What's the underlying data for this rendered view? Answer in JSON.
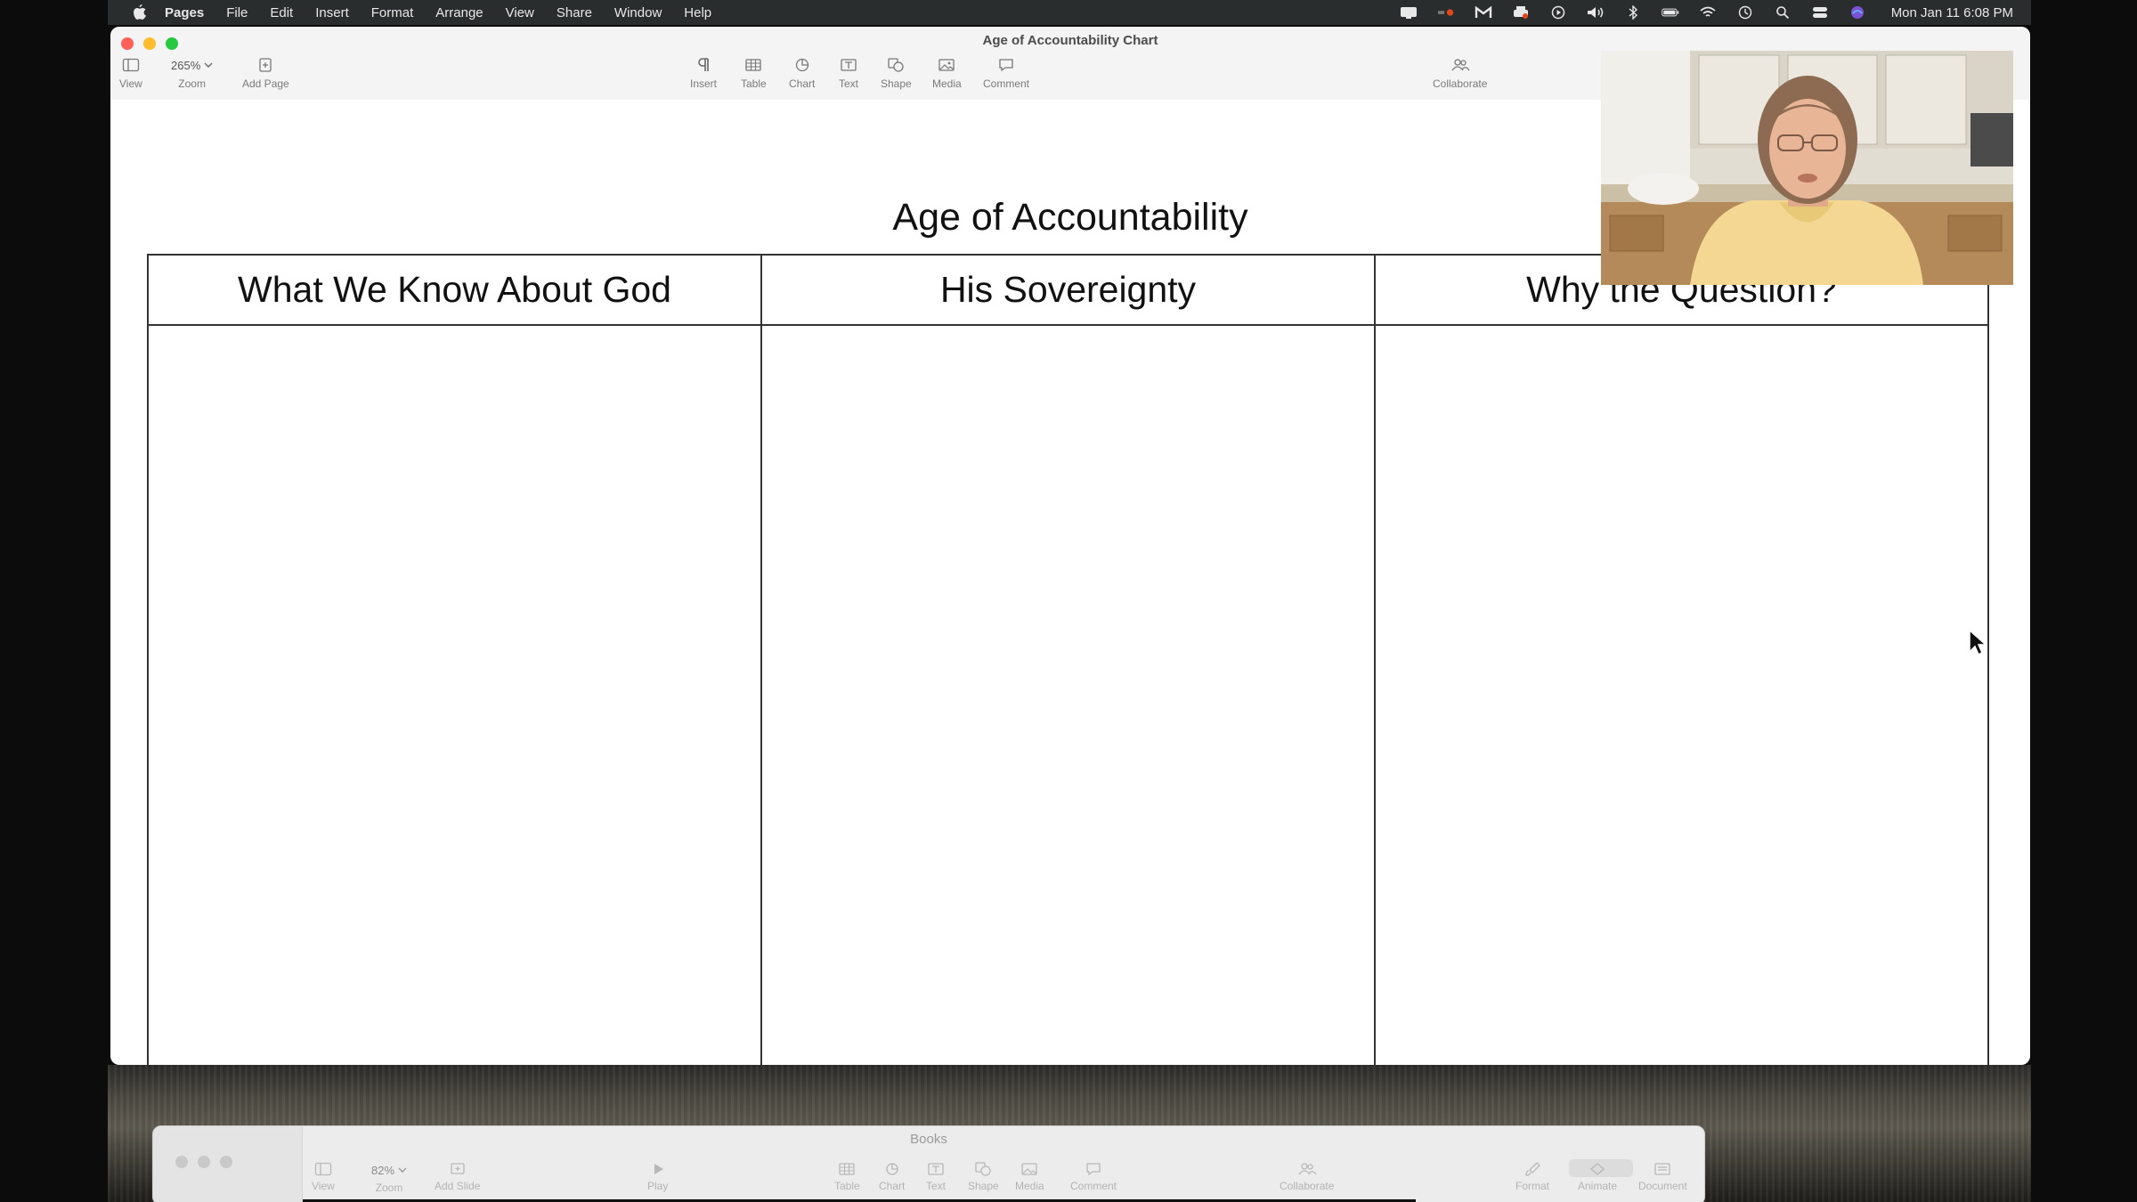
{
  "menubar": {
    "app_name": "Pages",
    "menus": [
      "File",
      "Edit",
      "Insert",
      "Format",
      "Arrange",
      "View",
      "Share",
      "Window",
      "Help"
    ],
    "clock": "Mon Jan 11  6:08 PM"
  },
  "window": {
    "title": "Age of Accountability Chart",
    "toolbar": {
      "view": "View",
      "zoom_value": "265%",
      "zoom": "Zoom",
      "add_page": "Add Page",
      "insert": "Insert",
      "table": "Table",
      "chart": "Chart",
      "text": "Text",
      "shape": "Shape",
      "media": "Media",
      "comment": "Comment",
      "collaborate": "Collaborate"
    }
  },
  "document": {
    "title": "Age of Accountability",
    "columns": [
      {
        "header": "What We Know About God"
      },
      {
        "header": "His Sovereignty"
      },
      {
        "header": "Why the Question?"
      }
    ]
  },
  "background_window": {
    "title": "Books",
    "toolbar": {
      "view": "View",
      "zoom_value": "82%",
      "zoom": "Zoom",
      "add_slide": "Add Slide",
      "play": "Play",
      "table": "Table",
      "chart": "Chart",
      "text": "Text",
      "shape": "Shape",
      "media": "Media",
      "comment": "Comment",
      "collaborate": "Collaborate",
      "format": "Format",
      "animate": "Animate",
      "document": "Document"
    }
  },
  "colors": {
    "menubar": "#2a2d2e",
    "window_toolbar": "#f4f4f4",
    "traffic_red": "#fe5f57",
    "traffic_yellow": "#febc2e",
    "traffic_green": "#28c840",
    "table_border": "#333333"
  }
}
